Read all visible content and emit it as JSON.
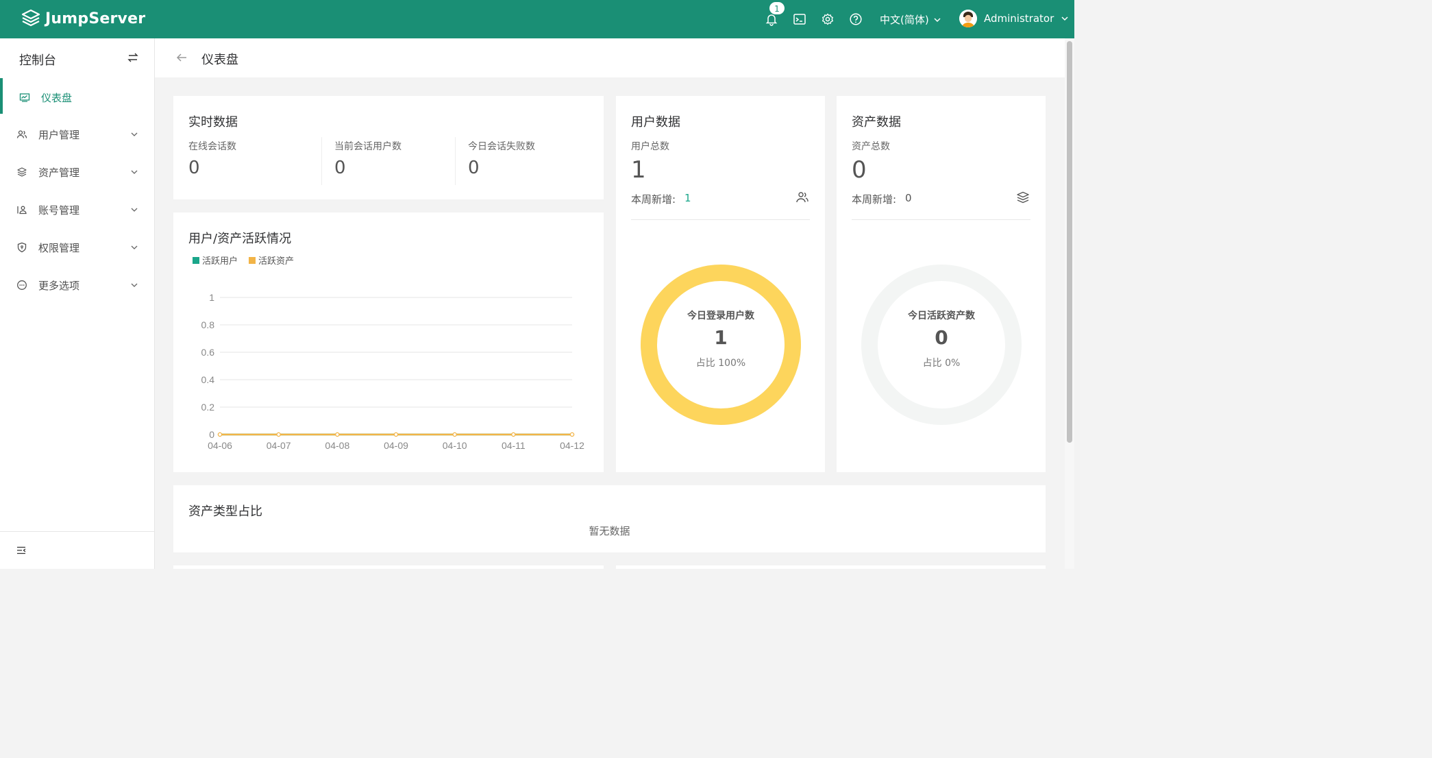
{
  "brand": {
    "name": "JumpServer"
  },
  "topbar": {
    "notification_count": "1",
    "language": "中文(简体)",
    "username": "Administrator",
    "icons": [
      "bell-icon",
      "terminal-icon",
      "settings-icon",
      "help-icon",
      "chevron-down-icon"
    ]
  },
  "sidebar": {
    "title": "控制台",
    "items": [
      {
        "label": "仪表盘",
        "icon": "dashboard-icon",
        "active": true
      },
      {
        "label": "用户管理",
        "icon": "users-icon"
      },
      {
        "label": "资产管理",
        "icon": "layers-icon"
      },
      {
        "label": "账号管理",
        "icon": "account-icon"
      },
      {
        "label": "权限管理",
        "icon": "shield-icon"
      },
      {
        "label": "更多选项",
        "icon": "more-icon"
      }
    ]
  },
  "page": {
    "title": "仪表盘"
  },
  "realtime": {
    "title": "实时数据",
    "metrics": [
      {
        "label": "在线会话数",
        "value": "0"
      },
      {
        "label": "当前会话用户数",
        "value": "0"
      },
      {
        "label": "今日会话失败数",
        "value": "0"
      }
    ]
  },
  "user_data": {
    "title": "用户数据",
    "total_label": "用户总数",
    "total": "1",
    "week_label": "本周新增:",
    "week_value": "1",
    "donut": {
      "title": "今日登录用户数",
      "value": "1",
      "pct": "占比 100%",
      "fraction": 1.0,
      "color": "#fdd55c"
    }
  },
  "asset_data": {
    "title": "资产数据",
    "total_label": "资产总数",
    "total": "0",
    "week_label": "本周新增:",
    "week_value": "0",
    "donut": {
      "title": "今日活跃资产数",
      "value": "0",
      "pct": "占比 0%",
      "fraction": 0.0,
      "color": "#f3f5f4"
    }
  },
  "activity": {
    "title": "用户/资产活跃情况",
    "chart_data": {
      "type": "line",
      "title": "用户/资产活跃情况",
      "x": [
        "04-06",
        "04-07",
        "04-08",
        "04-09",
        "04-10",
        "04-11",
        "04-12"
      ],
      "yticks": [
        "0",
        "0.2",
        "0.4",
        "0.6",
        "0.8",
        "1"
      ],
      "ylim": [
        0,
        1
      ],
      "grid": true,
      "legend": "top-left",
      "series": [
        {
          "name": "活跃用户",
          "values": [
            0,
            0,
            0,
            0,
            0,
            0,
            0
          ],
          "color": "#1aa68a"
        },
        {
          "name": "活跃资产",
          "values": [
            0,
            0,
            0,
            0,
            0,
            0,
            0
          ],
          "color": "#f2b447"
        }
      ]
    }
  },
  "asset_type": {
    "title": "资产类型占比",
    "empty": "暂无数据"
  },
  "colors": {
    "brand": "#1a8f75",
    "user_series": "#1aa68a",
    "asset_series": "#f2b447"
  }
}
